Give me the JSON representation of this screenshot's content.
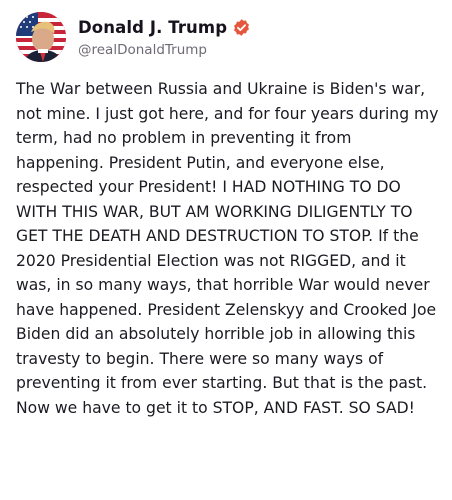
{
  "author": {
    "display_name": "Donald J. Trump",
    "handle": "@realDonaldTrump",
    "verified_icon": "verified-badge-icon",
    "verified_color": "#e4573d"
  },
  "post": {
    "text": "The War between Russia and Ukraine is Biden's war, not mine. I just got here, and for four years during my term, had no problem in preventing it from happening. President Putin, and everyone else, respected your President! I HAD NOTHING TO DO WITH THIS WAR, BUT AM WORKING DILIGENTLY TO GET THE DEATH AND DESTRUCTION TO STOP. If the 2020 Presidential Election was not RIGGED, and it was, in so many ways, that horrible War would never have happened. President Zelenskyy and Crooked Joe Biden did an absolutely horrible job in allowing this travesty to begin. There were so many ways of preventing it from ever starting. But that is the past. Now we have to get it to STOP, AND FAST. SO SAD!"
  }
}
